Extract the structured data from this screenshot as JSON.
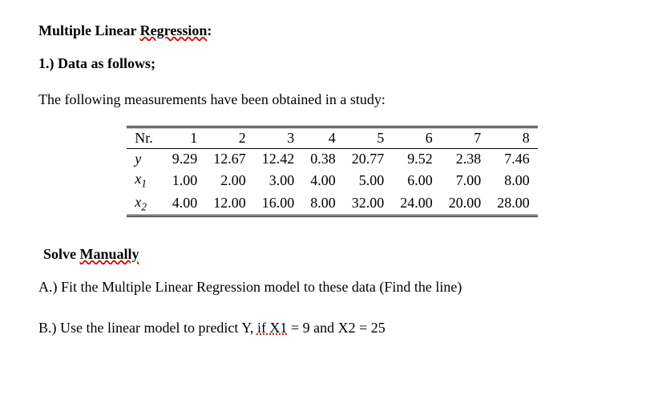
{
  "title_prefix": "Multiple Linear ",
  "title_underlined": "Regression",
  "title_suffix": ":",
  "data_heading": "1.) Data as follows;",
  "intro": "The following measurements have been obtained in a study:",
  "table": {
    "row_labels": {
      "nr": "Nr.",
      "y": "y",
      "x1_main": "x",
      "x1_sub": "1",
      "x2_main": "x",
      "x2_sub": "2"
    },
    "nr": [
      "1",
      "2",
      "3",
      "4",
      "5",
      "6",
      "7",
      "8"
    ],
    "y": [
      "9.29",
      "12.67",
      "12.42",
      "0.38",
      "20.77",
      "9.52",
      "2.38",
      "7.46"
    ],
    "x1": [
      "1.00",
      "2.00",
      "3.00",
      "4.00",
      "5.00",
      "6.00",
      "7.00",
      "8.00"
    ],
    "x2": [
      "4.00",
      "12.00",
      "16.00",
      "8.00",
      "32.00",
      "24.00",
      "20.00",
      "28.00"
    ]
  },
  "solve_prefix": "Solve ",
  "solve_underlined": "Manually",
  "qa": "A.) Fit the Multiple Linear Regression model to these data (Find the line)",
  "qb_prefix": "B.) Use the linear model to predict Y, ",
  "qb_if_part": "if  X1",
  "qb_suffix": " = 9 and X2 = 25"
}
